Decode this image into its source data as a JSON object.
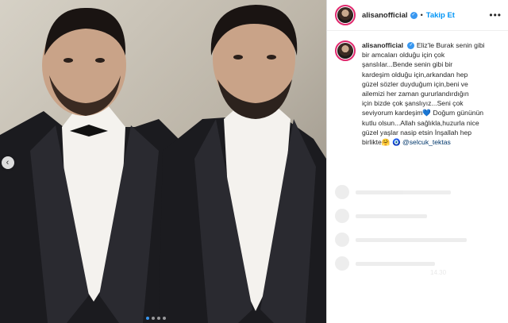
{
  "post": {
    "username": "alisanofficial",
    "separator": "•",
    "follow_label": "Takip Et",
    "more_label": "•••",
    "verified_glyph": "✓",
    "caption": {
      "username": "alisanofficial",
      "line_1": "Eliz'le Burak senin gibi",
      "line_2": "bir amcaları olduğu için çok",
      "line_3": "şanslılar...Bende senin gibi bir",
      "line_4": "kardeşim olduğu için,arkandan hep",
      "line_5": "güzel sözler duyduğum için,beni ve",
      "line_6": "ailemizi her zaman gururlandırdığın",
      "line_7": "için bizde çok şanslıyız...Seni çok",
      "line_8": "seviyorum kardeşim",
      "line_8_tail": "Doğum gününün",
      "line_9": "kutlu olsun...Allah sağlıkla,huzurla nice",
      "line_10": "güzel yaşlar nasip etsin İnşallah hep",
      "line_11": "birlikte",
      "mention": "@selcuk_tektas",
      "heart": "💙",
      "hug_emoji": "🤗",
      "eye_emoji": "🧿"
    },
    "faded_time": "14.30"
  },
  "media": {
    "prev_icon": "‹",
    "dot_count": 4,
    "active_dot": 0,
    "colors": {
      "background": "#c8c2b6",
      "tuxedo": "#1b1b1f",
      "shirt": "#f4f2ee",
      "skin": "#c9a388",
      "hair": "#1a1412"
    }
  }
}
